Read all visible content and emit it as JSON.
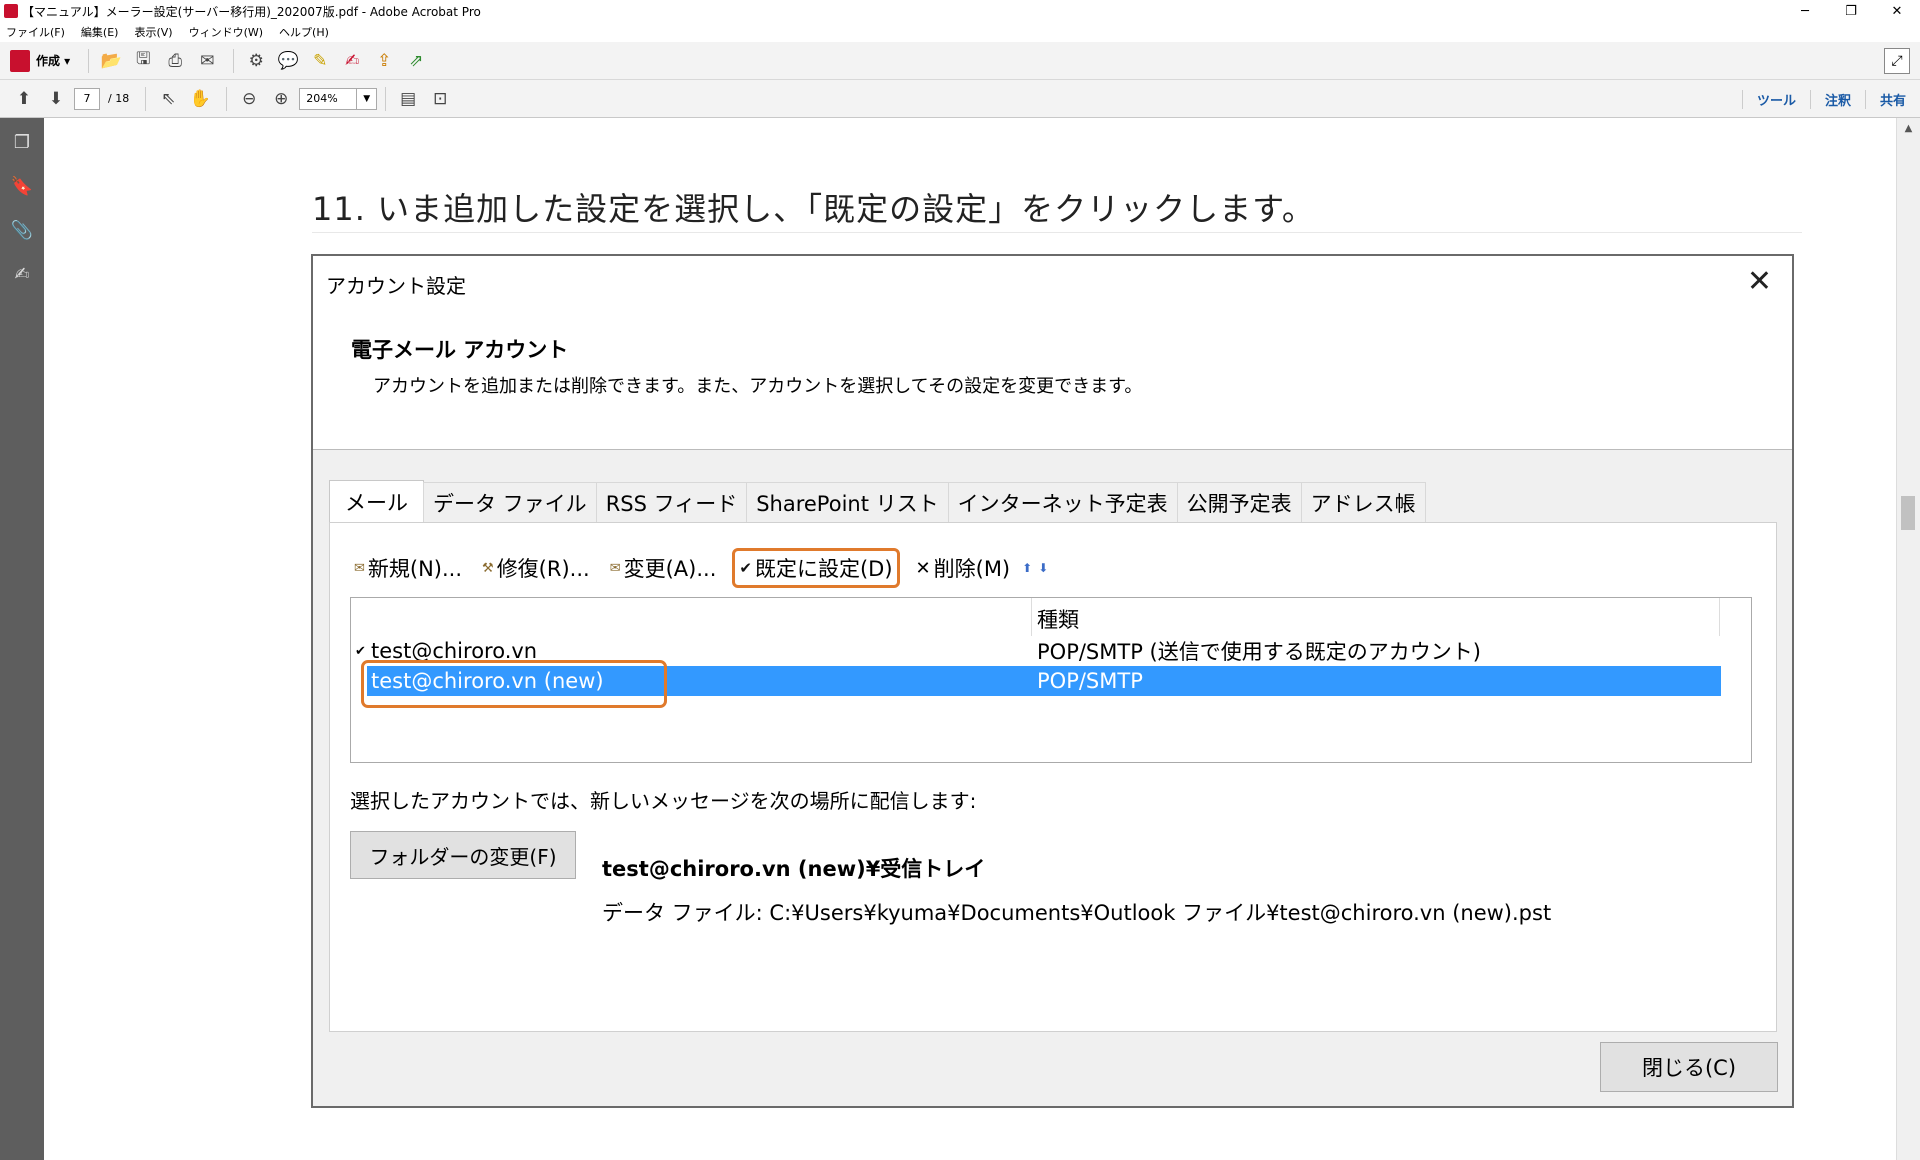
{
  "window": {
    "title": "【マニュアル】メーラー設定(サーバー移行用)_202007版.pdf - Adobe Acrobat Pro",
    "minimize": "─",
    "restore": "❐",
    "close": "✕"
  },
  "menu": [
    "ファイル(F)",
    "編集(E)",
    "表示(V)",
    "ウィンドウ(W)",
    "ヘルプ(H)"
  ],
  "toolbar": {
    "create_label": "作成 ▾",
    "page_current": "7",
    "page_total": "/ 18",
    "zoom": "204%",
    "zoom_dropdown": "▼",
    "right_links": [
      "ツール",
      "注釈",
      "共有"
    ]
  },
  "document": {
    "step_title": "11. いま追加した設定を選択し、「既定の設定」をクリックします。"
  },
  "dialog": {
    "title": "アカウント設定",
    "close_glyph": "✕",
    "heading": "電子メール アカウント",
    "description": "アカウントを追加または削除できます。また、アカウントを選択してその設定を変更できます。",
    "tabs": [
      "メール",
      "データ ファイル",
      "RSS フィード",
      "SharePoint リスト",
      "インターネット予定表",
      "公開予定表",
      "アドレス帳"
    ],
    "actions": {
      "new": "新規(N)...",
      "repair": "修復(R)...",
      "change": "変更(A)...",
      "set_default": "既定に設定(D)",
      "delete": "削除(M)",
      "delete_glyph": "✕",
      "arrows": "⬆⬇"
    },
    "grid": {
      "col_type": "種類",
      "rows": [
        {
          "name": "test@chiroro.vn",
          "type": "POP/SMTP (送信で使用する既定のアカウント)",
          "default": true
        },
        {
          "name": "test@chiroro.vn (new)",
          "type": "POP/SMTP",
          "default": false,
          "selected": true
        }
      ]
    },
    "deliver_label": "選択したアカウントでは、新しいメッセージを次の場所に配信します:",
    "folder_button": "フォルダーの変更(F)",
    "deliver_path": "test@chiroro.vn (new)¥受信トレイ",
    "data_file": "データ ファイル: C:¥Users¥kyuma¥Documents¥Outlook ファイル¥test@chiroro.vn (new).pst",
    "close_button": "閉じる(C)"
  },
  "colors": {
    "highlight": "#e07a2c",
    "selection": "#3399ff",
    "link": "#1a5aa6"
  }
}
